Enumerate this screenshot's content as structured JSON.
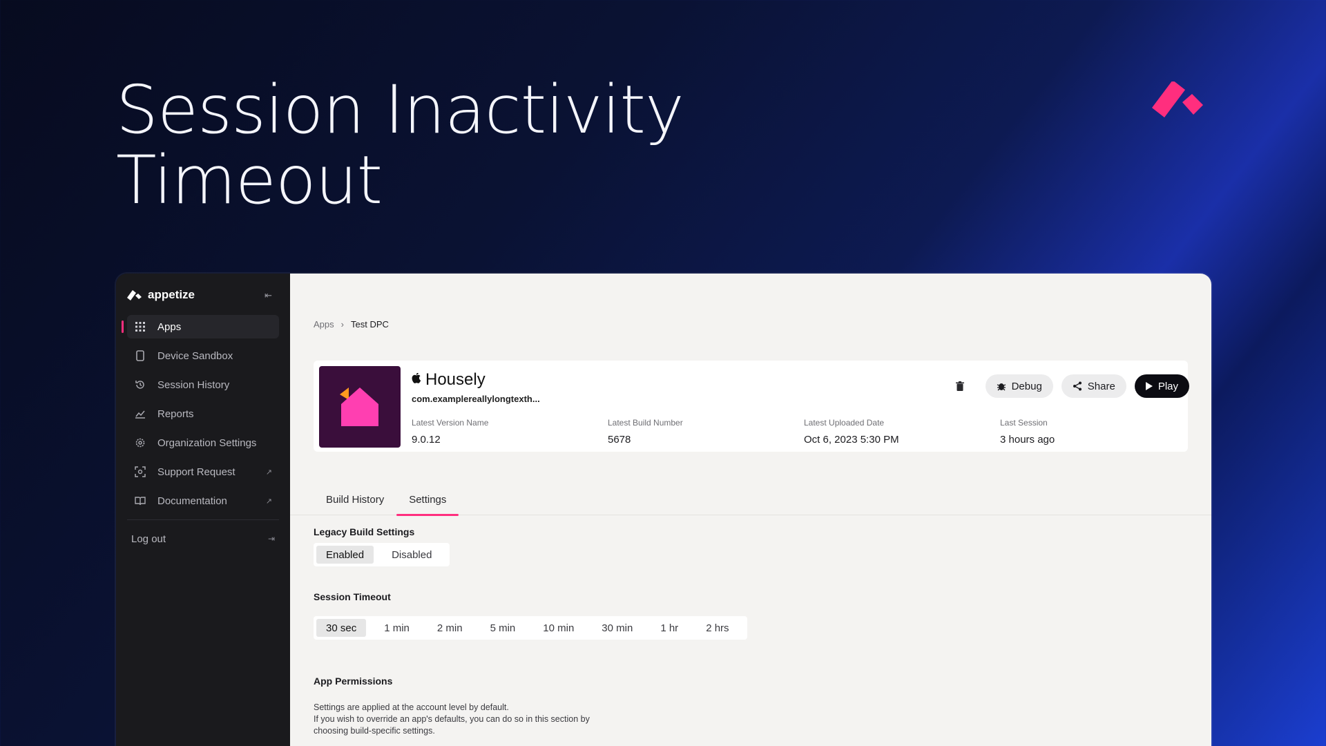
{
  "headline": {
    "line1": "Session Inactivity",
    "line2": "Timeout"
  },
  "colors": {
    "accent": "#ff2e7e",
    "sidebar_bg": "#1a1a1d",
    "main_bg": "#f4f3f1",
    "app_icon_bg": "#3a0e3b"
  },
  "sidebar": {
    "brand": "appetize",
    "items": [
      {
        "label": "Apps",
        "icon": "grid-icon",
        "active": true
      },
      {
        "label": "Device Sandbox",
        "icon": "phone-icon"
      },
      {
        "label": "Session History",
        "icon": "history-icon"
      },
      {
        "label": "Reports",
        "icon": "chart-icon"
      },
      {
        "label": "Organization Settings",
        "icon": "gear-icon"
      },
      {
        "label": "Support Request",
        "icon": "support-icon",
        "external": true
      },
      {
        "label": "Documentation",
        "icon": "book-icon",
        "external": true
      }
    ],
    "logout": "Log out"
  },
  "breadcrumb": {
    "root": "Apps",
    "separator": "›",
    "current": "Test DPC"
  },
  "app": {
    "name": "Housely",
    "platform_icon": "apple-icon",
    "bundle_id": "com.examplereallylongtexth...",
    "meta": [
      {
        "label": "Latest Version Name",
        "value": "9.0.12"
      },
      {
        "label": "Latest Build Number",
        "value": "5678"
      },
      {
        "label": "Latest Uploaded Date",
        "value": "Oct 6, 2023 5:30 PM"
      },
      {
        "label": "Last Session",
        "value": "3 hours ago"
      }
    ],
    "actions": {
      "debug": "Debug",
      "share": "Share",
      "play": "Play"
    }
  },
  "tabs": [
    {
      "label": "Build History",
      "active": false
    },
    {
      "label": "Settings",
      "active": true
    }
  ],
  "settings": {
    "legacy": {
      "title": "Legacy Build Settings",
      "options": [
        "Enabled",
        "Disabled"
      ],
      "selected": "Enabled"
    },
    "timeout": {
      "title": "Session Timeout",
      "options": [
        "30 sec",
        "1 min",
        "2 min",
        "5 min",
        "10 min",
        "30 min",
        "1 hr",
        "2 hrs"
      ],
      "selected": "30 sec"
    },
    "permissions": {
      "title": "App Permissions",
      "desc1": "Settings are applied at the account level by default.",
      "desc2": "If you wish to override an app's defaults, you can do so in this section by choosing build-specific settings."
    }
  }
}
